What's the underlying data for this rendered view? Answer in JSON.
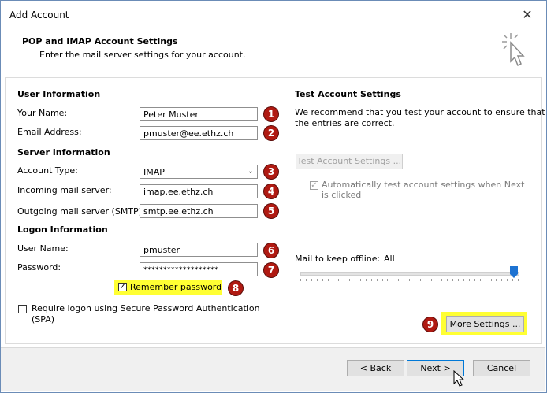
{
  "window": {
    "title": "Add Account",
    "close_glyph": "✕"
  },
  "header": {
    "title": "POP and IMAP Account Settings",
    "subtitle": "Enter the mail server settings for your account."
  },
  "user_info": {
    "heading": "User Information",
    "name_label": "Your Name:",
    "name_value": "Peter Muster",
    "email_label": "Email Address:",
    "email_value": "pmuster@ee.ethz.ch"
  },
  "server_info": {
    "heading": "Server Information",
    "account_type_label": "Account Type:",
    "account_type_value": "IMAP",
    "incoming_label": "Incoming mail server:",
    "incoming_value": "imap.ee.ethz.ch",
    "outgoing_label": "Outgoing mail server (SMTP):",
    "outgoing_value": "smtp.ee.ethz.ch"
  },
  "logon_info": {
    "heading": "Logon Information",
    "username_label": "User Name:",
    "username_value": "pmuster",
    "password_label": "Password:",
    "password_value": "*******************",
    "remember_label": "Remember password",
    "remember_checked": true,
    "spa_label_line1": "Require logon using Secure Password Authentication",
    "spa_label_line2": "(SPA)",
    "spa_checked": false
  },
  "test_settings": {
    "heading": "Test Account Settings",
    "description_line1": "We recommend that you test your account to ensure that",
    "description_line2": "the entries are correct.",
    "test_button": "Test Account Settings ...",
    "auto_test_line1": "Automatically test account settings when Next",
    "auto_test_line2": "is clicked",
    "auto_test_checked": true
  },
  "offline": {
    "label": "Mail to keep offline:",
    "value": "All",
    "slider_level": 1.0
  },
  "more_settings_button": "More Settings ...",
  "footer": {
    "back": "< Back",
    "next": "Next >",
    "cancel": "Cancel"
  },
  "badges": [
    "1",
    "2",
    "3",
    "4",
    "5",
    "6",
    "7",
    "8",
    "9"
  ],
  "colors": {
    "badge": "#b01a12",
    "highlight": "#ffff33",
    "slider_thumb": "#1e73d2"
  }
}
